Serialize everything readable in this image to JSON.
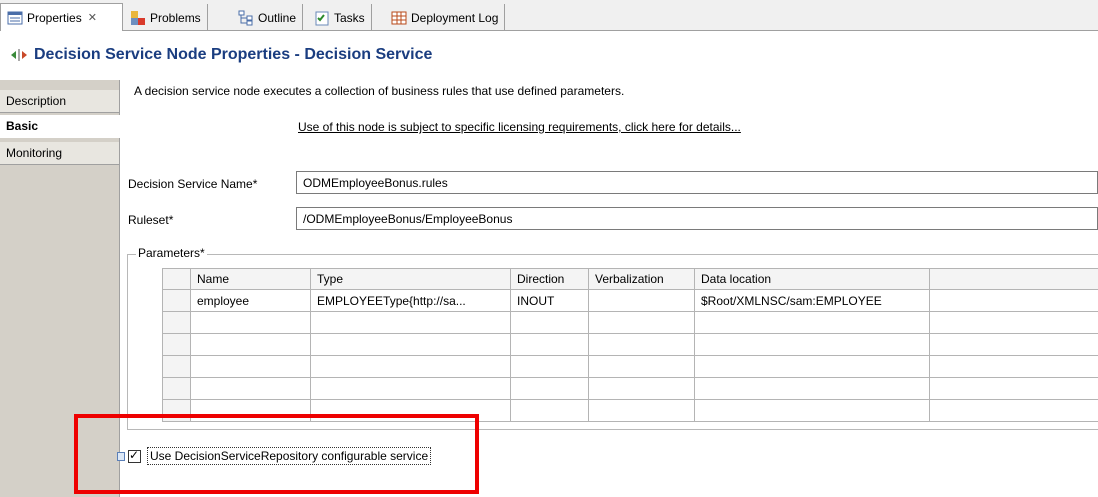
{
  "tabs": [
    {
      "label": "Properties",
      "icon": "properties-icon",
      "active": true
    },
    {
      "label": "Problems",
      "icon": "problems-icon"
    },
    {
      "label": "Outline",
      "icon": "outline-icon"
    },
    {
      "label": "Tasks",
      "icon": "tasks-icon"
    },
    {
      "label": "Deployment Log",
      "icon": "deployment-log-icon"
    }
  ],
  "tab_close": "✕",
  "page_title": "Decision Service Node Properties - Decision Service",
  "sidenav": [
    {
      "label": "Description"
    },
    {
      "label": "Basic",
      "active": true
    },
    {
      "label": "Monitoring"
    }
  ],
  "description": "A decision service node executes a collection of business rules that use defined parameters.",
  "license_link": "Use of this node is subject to specific licensing requirements, click here for details...",
  "fields": {
    "decision_service_name": {
      "label": "Decision Service Name*",
      "value": "ODMEmployeeBonus.rules"
    },
    "ruleset": {
      "label": "Ruleset*",
      "value": "/ODMEmployeeBonus/EmployeeBonus"
    }
  },
  "parameters": {
    "legend": "Parameters*",
    "columns": [
      "Name",
      "Type",
      "Direction",
      "Verbalization",
      "Data location",
      ""
    ],
    "rows": [
      [
        "employee",
        "EMPLOYEEType{http://sa...",
        "INOUT",
        "",
        "$Root/XMLNSC/sam:EMPLOYEE",
        ""
      ],
      [
        "",
        "",
        "",
        "",
        "",
        ""
      ],
      [
        "",
        "",
        "",
        "",
        "",
        ""
      ],
      [
        "",
        "",
        "",
        "",
        "",
        ""
      ],
      [
        "",
        "",
        "",
        "",
        "",
        ""
      ],
      [
        "",
        "",
        "",
        "",
        "",
        ""
      ]
    ]
  },
  "checkbox": {
    "label": "Use DecisionServiceRepository configurable service",
    "checked": true
  },
  "colors": {
    "title": "#1a3d80",
    "highlight": "#ee0000",
    "nav_bg": "#d4d0c8"
  }
}
